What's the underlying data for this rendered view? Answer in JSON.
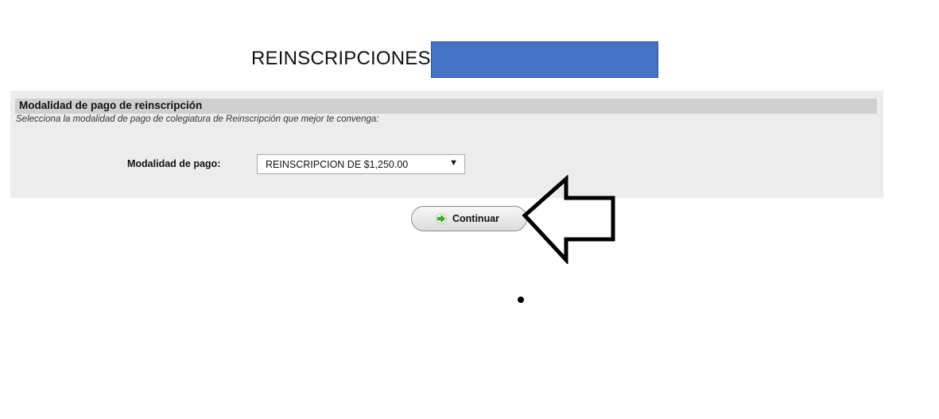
{
  "page": {
    "title": "REINSCRIPCIONES"
  },
  "panel": {
    "title": "Modalidad de pago de reinscripción",
    "subtitle": "Selecciona la modalidad de pago de colegiatura de Reinscripción que mejor te convenga:",
    "field_label": "Modalidad de pago:",
    "select": {
      "selected_value": "REINSCRIPCION DE $1,250.00"
    }
  },
  "actions": {
    "continue_label": "Continuar",
    "continue_icon": "arrow-right-icon"
  },
  "colors": {
    "redaction": "#4472c4",
    "panel_background": "#ececec",
    "panel_header": "#cfcfcf",
    "icon_green": "#3cae2e"
  }
}
